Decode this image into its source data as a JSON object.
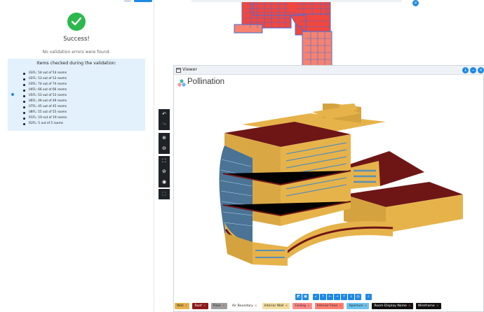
{
  "validation": {
    "title": "Success!",
    "message": "No validation errors were found.",
    "items_heading": "Items checked during the validation:",
    "items": [
      "03FL: 54 out of 54 rooms",
      "02FL: 53 out of 53 rooms",
      "03FL: 74 out of 74 rooms",
      "04FL: 66 out of 66 rooms",
      "05FL: 53 out of 53 rooms",
      "06FL: 49 out of 49 rooms",
      "07FL: 45 out of 45 rooms",
      "08FL: 55 out of 55 rooms",
      "R1FL: 19 out of 19 rooms",
      "R2FL: 5 out of 5 rooms"
    ]
  },
  "viewer": {
    "title": "Viewer",
    "brand": "Pollination"
  },
  "icons": {
    "success": "check-circle-icon",
    "tools": [
      "undo-icon",
      "redo-icon",
      "zoom-in-icon",
      "zoom-out-icon",
      "fit-view-icon",
      "hide-icon",
      "show-icon",
      "square-icon"
    ]
  },
  "legend": [
    {
      "label": "Wall",
      "color": "#e6b34b"
    },
    {
      "label": "Roof",
      "color": "#8b1a1a"
    },
    {
      "label": "Floor",
      "color": "#9e9e9e"
    },
    {
      "label": "Air Boundary",
      "color": "#ffffff"
    },
    {
      "label": "Interior Wall",
      "color": "#f3dfa0"
    },
    {
      "label": "Ceiling",
      "color": "#ff8a8a"
    },
    {
      "label": "Interior Floor",
      "color": "#ff7f73"
    },
    {
      "label": "Aperture",
      "color": "#6cc4f0"
    },
    {
      "label": "Room Display Name",
      "color": "#111111"
    },
    {
      "label": "Wireframe",
      "color": "#111111"
    }
  ],
  "colors": {
    "accent": "#1e88e5",
    "success": "#2db84d",
    "wall": "#e6b34b",
    "roof": "#6e1616",
    "window": "#5b8fb5",
    "plan_red": "#f0473f",
    "plan_blue": "#3f6fe0"
  }
}
